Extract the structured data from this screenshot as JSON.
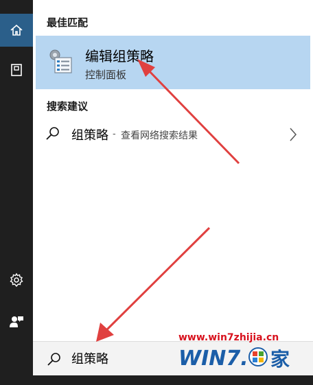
{
  "sidebar": {
    "items": [
      {
        "icon": "home-icon"
      },
      {
        "icon": "notebook-icon"
      },
      {
        "icon": "gear-icon"
      },
      {
        "icon": "feedback-icon"
      }
    ]
  },
  "best_match": {
    "header": "最佳匹配",
    "title": "编辑组策略",
    "subtitle": "控制面板",
    "icon": "group-policy-icon"
  },
  "suggestions": {
    "header": "搜索建议",
    "items": [
      {
        "term": "组策略",
        "separator": "-",
        "hint": "查看网络搜索结果",
        "icon": "search-icon",
        "chevron": "chevron-right-icon"
      }
    ]
  },
  "search": {
    "value": "组策略",
    "icon": "search-icon"
  },
  "watermark": {
    "url": "www.win7zhijia.cn",
    "logo_text": "WIN7.之家"
  },
  "colors": {
    "sidebar_bg": "#1f1f1f",
    "sidebar_active": "#2b5f8a",
    "highlight": "#b7d6f1",
    "arrow": "#e0403f",
    "watermark": "#d8111d"
  }
}
